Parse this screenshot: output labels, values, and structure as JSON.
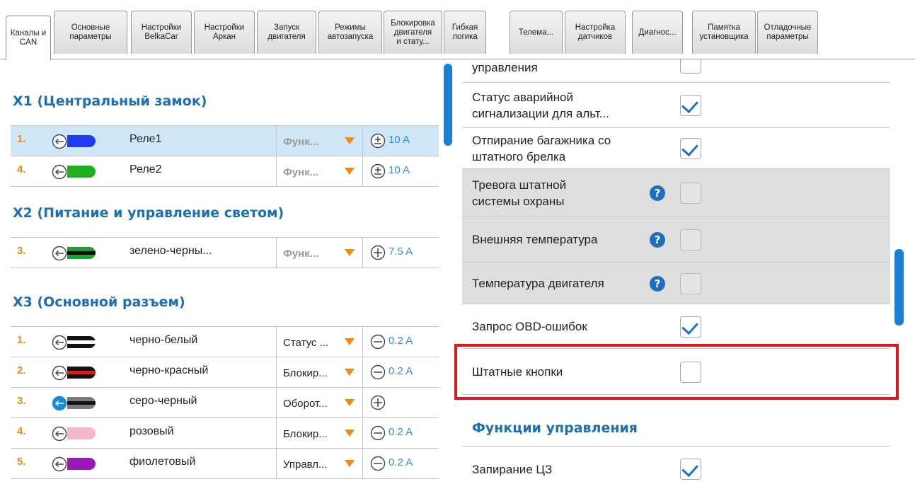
{
  "tabs": [
    {
      "label": "Каналы и\nCAN",
      "active": true
    },
    {
      "label": "Основные\nпараметры"
    },
    {
      "label": "Настройки\nBelkaCar"
    },
    {
      "label": "Настройки\nАркан"
    },
    {
      "label": "Запуск\nдвигателя"
    },
    {
      "label": "Режимы\nавтозапуска"
    },
    {
      "label": "Блокировка\nдвигателя\nи стату..."
    },
    {
      "label": "Гибкая\nлогика"
    },
    {
      "label": "Телема..."
    },
    {
      "label": "Настройка\nдатчиков"
    },
    {
      "label": "Диагнос..."
    },
    {
      "label": "Памятка\nустановщика"
    },
    {
      "label": "Отладочные\nпараметры"
    }
  ],
  "sections": [
    {
      "title": "X1 (Центральный замок)",
      "rows": [
        {
          "num": "1.",
          "wire": "Реле1",
          "wire_color": "#1f3cf0",
          "function": "Функ...",
          "function_set": false,
          "power": "plusminus",
          "amp": "10 A",
          "selected": true
        },
        {
          "num": "4.",
          "wire": "Реле2",
          "wire_color": "#1fb01f",
          "function": "Функ...",
          "function_set": false,
          "power": "plusminus",
          "amp": "10 A"
        }
      ]
    },
    {
      "title": "X2 (Питание и управление светом)",
      "rows": [
        {
          "num": "3.",
          "wire": "зелено-черны...",
          "wire_color": "#19a332",
          "stripe": "#000",
          "function": "Функ...",
          "function_set": false,
          "power": "plus",
          "amp": "7.5 A"
        }
      ]
    },
    {
      "title": "X3 (Основной разъем)",
      "rows": [
        {
          "num": "1.",
          "wire": "черно-белый",
          "wire_color": "#111",
          "stripe": "#fff",
          "function": "Статус ...",
          "function_set": true,
          "power": "minus",
          "amp": "0.2 A"
        },
        {
          "num": "2.",
          "wire": "черно-красный",
          "wire_color": "#111",
          "stripe": "#e01818",
          "function": "Блокир...",
          "function_set": true,
          "power": "minus",
          "amp": "0.2 A"
        },
        {
          "num": "3.",
          "wire": "серо-черный",
          "wire_color": "#7a7a7a",
          "stripe": "#111",
          "function": "Оборот...",
          "function_set": true,
          "power": "plus",
          "amp": "",
          "active_icon": true
        },
        {
          "num": "4.",
          "wire": "розовый",
          "wire_color": "#f5b8c8",
          "function": "Блокир...",
          "function_set": true,
          "power": "minus",
          "amp": "0.2 A"
        },
        {
          "num": "5.",
          "wire": "фиолетовый",
          "wire_color": "#9a18b8",
          "function": "Управл...",
          "function_set": true,
          "power": "minus",
          "amp": "0.2 A"
        }
      ]
    }
  ],
  "params": [
    {
      "label": "управления",
      "checked": false,
      "gray": false
    },
    {
      "label": "Статус аварийной\nсигнализации для альт...",
      "checked": true,
      "gray": false
    },
    {
      "label": "Отпирание багажника со\nштатного брелка",
      "checked": true,
      "gray": false
    },
    {
      "label": "Тревога штатной\nсистемы охраны",
      "checked": false,
      "gray": true,
      "help": "?"
    },
    {
      "label": "Внешняя температура",
      "checked": false,
      "gray": true,
      "help": "?"
    },
    {
      "label": "Температура двигателя",
      "checked": false,
      "gray": true,
      "help": "?"
    },
    {
      "label": "Запрос OBD-ошибок",
      "checked": true,
      "gray": false
    },
    {
      "label": "Штатные кнопки",
      "checked": false,
      "gray": false,
      "highlighted": true
    }
  ],
  "control_functions": {
    "title": "Функции управления",
    "items": [
      {
        "label": "Запирание ЦЗ",
        "checked": true
      }
    ]
  }
}
